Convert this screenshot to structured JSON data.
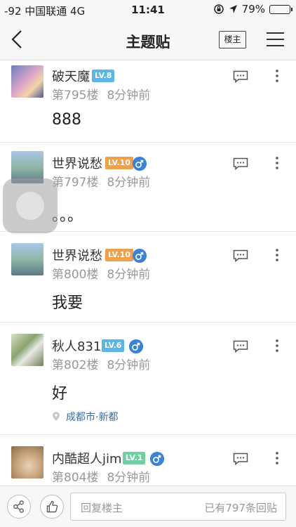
{
  "status": {
    "carrier": "-92 中国联通 4G",
    "time": "11:41",
    "battery": "79%",
    "battery_level": 0.79
  },
  "nav": {
    "title": "主题贴",
    "owner_label": "楼主"
  },
  "posts": [
    {
      "username": "破天魔",
      "level": "LV.8",
      "floor": "第795楼",
      "time": "8分钟前",
      "content": "888"
    },
    {
      "username": "世界说愁",
      "level": "LV.10",
      "floor": "第797楼",
      "time": "8分钟前",
      "content": "。。。"
    },
    {
      "username": "世界说愁",
      "level": "LV.10",
      "floor": "第800楼",
      "time": "8分钟前",
      "content": "我要"
    },
    {
      "username": "秋人831",
      "level": "LV.6",
      "floor": "第802楼",
      "time": "8分钟前",
      "content": "好",
      "location": "成都市·新都"
    },
    {
      "username": "内酷超人jim",
      "level": "LV.1",
      "floor": "第804楼",
      "time": "8分钟前"
    }
  ],
  "bottom": {
    "placeholder": "回复楼主",
    "reply_count": "已有797条回贴"
  },
  "colors": {
    "lv_blue": "#5ab6e6",
    "lv_orange": "#f0a04b",
    "lv_green": "#6fd0a3",
    "male": "#3a82d7",
    "link": "#3b6ea8"
  }
}
